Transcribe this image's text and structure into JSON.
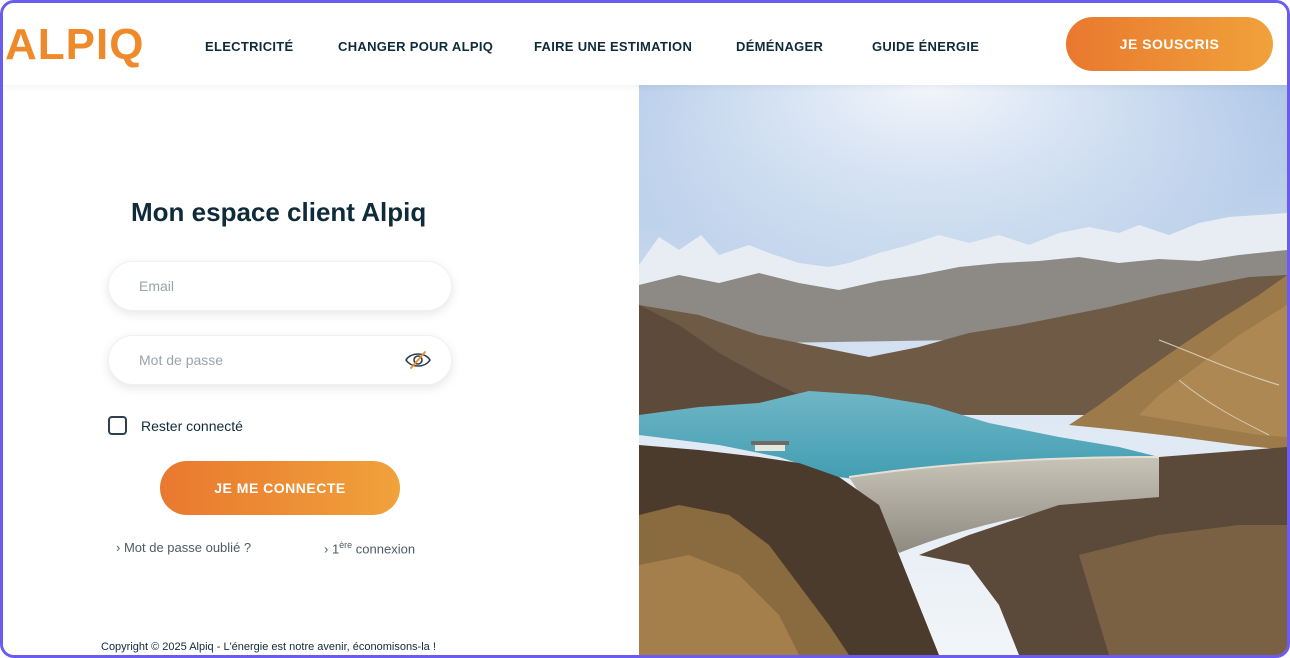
{
  "header": {
    "logo": "ALPIQ",
    "nav": [
      {
        "label": "ELECTRICITÉ"
      },
      {
        "label": "CHANGER POUR ALPIQ"
      },
      {
        "label": "FAIRE UNE ESTIMATION"
      },
      {
        "label": "DÉMÉNAGER"
      },
      {
        "label": "GUIDE ÉNERGIE"
      }
    ],
    "cta": "JE SOUSCRIS"
  },
  "login": {
    "title": "Mon espace client Alpiq",
    "email_placeholder": "Email",
    "password_placeholder": "Mot de passe",
    "remember_label": "Rester connecté",
    "submit": "JE ME CONNECTE",
    "forgot": "› Mot de passe oublié ?",
    "first_prefix": "› 1",
    "first_sup": "ère",
    "first_suffix": " connexion"
  },
  "footer": {
    "copyright": "Copyright © 2025 Alpiq - L'énergie est notre avenir, économisons-la !"
  },
  "colors": {
    "accent_start": "#e9782f",
    "accent_end": "#f0a23b",
    "text_dark": "#0f2b3a",
    "frame": "#6a5cf0"
  },
  "icons": {
    "password_toggle": "eye-slash-icon"
  }
}
